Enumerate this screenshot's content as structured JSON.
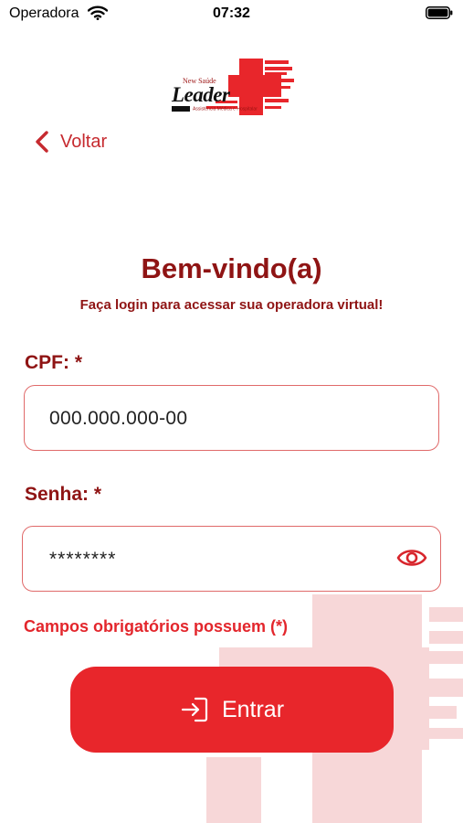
{
  "status_bar": {
    "carrier": "Operadora",
    "time": "07:32",
    "wifi_icon": "wifi-icon",
    "battery_icon": "battery-icon"
  },
  "logo": {
    "tagline": "New Saúde",
    "wordmark": "Leader",
    "subline": "Assistência Médica e Hospitalar",
    "brand_color": "#e8262b"
  },
  "nav": {
    "back_label": "Voltar",
    "back_icon": "chevron-left-icon"
  },
  "header": {
    "title": "Bem-vindo(a)",
    "subtitle": "Faça login para acessar sua operadora virtual!"
  },
  "form": {
    "cpf_label": "CPF: *",
    "cpf_value": "000.000.000-00",
    "password_label": "Senha: *",
    "password_value": "********",
    "password_toggle_icon": "eye-icon",
    "required_note": "Campos obrigatórios possuem (*)"
  },
  "actions": {
    "submit_label": "Entrar",
    "submit_icon": "login-icon"
  },
  "colors": {
    "primary": "#e8262b",
    "title": "#8f1414",
    "field_border": "#e06a6a",
    "background": "#ffffff"
  }
}
